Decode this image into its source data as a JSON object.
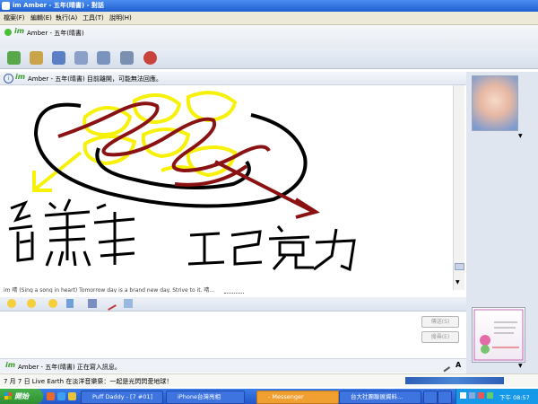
{
  "window": {
    "title": "Amber - 五年(晴書) - 對話",
    "title_prefix": "im"
  },
  "menu": [
    "檔案(F)",
    "編輯(E)",
    "執行(A)",
    "工具(T)",
    "說明(H)"
  ],
  "contact": {
    "logo": "im",
    "name": "Amber - 五年(晴書)"
  },
  "toolbar_icons": [
    "invite-icon",
    "send-file-icon",
    "webcam-icon",
    "call-icon",
    "activity-icon",
    "games-icon",
    "block-icon"
  ],
  "status_line": {
    "logo": "im",
    "text": "Amber - 五年(晴書) 目前離開，可能無法回應。"
  },
  "drawing": {
    "labels": [
      "香蕉",
      "巧克力"
    ],
    "colors": {
      "outline": "#000000",
      "banana": "#f7f10a",
      "chocolate": "#8a1212"
    }
  },
  "partial_message": "im 晴 (Sing a song in heart) Tomorrow day is a brand new day. Strive to it. 晴...",
  "input_toolbar_icons": [
    "emoticon-icon",
    "wink-icon",
    "nudge-icon",
    "voice-clip-icon",
    "handwriting-icon",
    "background-icon"
  ],
  "buttons": {
    "send": "傳送(S)",
    "search": "搜尋(E)"
  },
  "typing": {
    "logo": "im",
    "text": "Amber - 五年(晴書) 正在寫入訊息。"
  },
  "news_ticker": "7 月 7 日 Live Earth 在淡洋音樂祭：一起是光閃閃愛地球！",
  "taskbar": {
    "start": "開始",
    "tasks": [
      "Puff Daddy - [7 #01]",
      "iPhone台灣亮相",
      "- Messenger",
      "台大社團聯展資料...",
      "",
      ""
    ],
    "clock": "下午 08:57"
  },
  "accent_colors": {
    "title": "#2a64d8",
    "taskbar": "#2f63d2",
    "start": "#3aa23f",
    "logo": "#3a9a2a"
  }
}
